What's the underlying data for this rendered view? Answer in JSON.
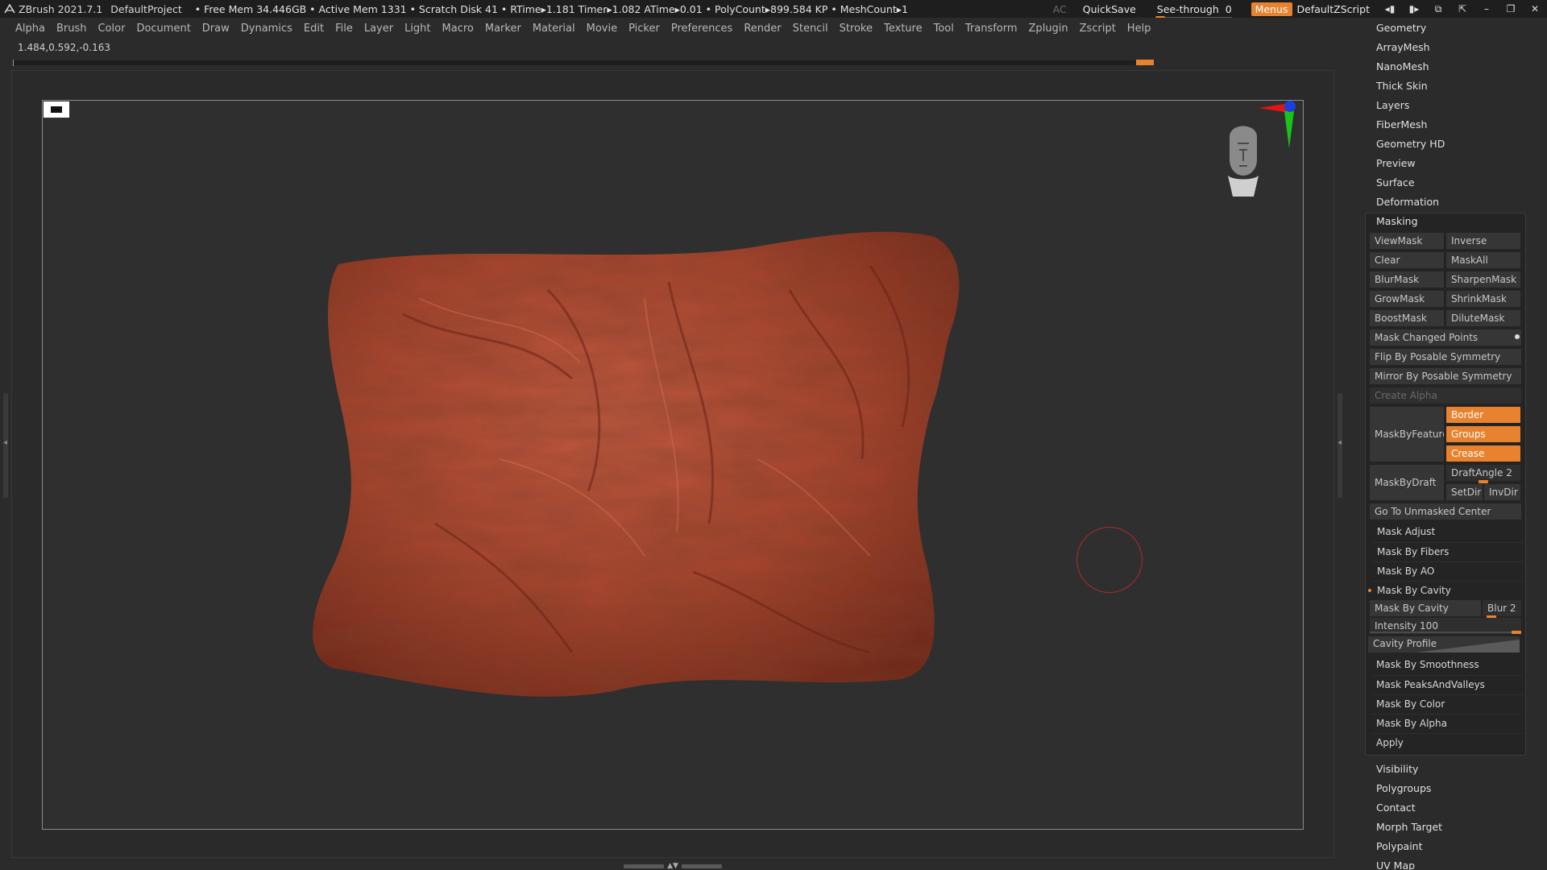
{
  "titlebar": {
    "app": "ZBrush 2021.7.1",
    "project": "DefaultProject",
    "stats": "• Free Mem 34.446GB • Active Mem 1331 • Scratch Disk 41 •  RTime▸1.181 Timer▸1.082 ATime▸0.01 • PolyCount▸899.584 KP  • MeshCount▸1",
    "ac": "AC",
    "quicksave": "QuickSave",
    "seethrough_label": "See-through",
    "seethrough_value": "0",
    "menus": "Menus",
    "zscript": "DefaultZScript"
  },
  "menus": [
    "Alpha",
    "Brush",
    "Color",
    "Document",
    "Draw",
    "Dynamics",
    "Edit",
    "File",
    "Layer",
    "Light",
    "Macro",
    "Marker",
    "Material",
    "Movie",
    "Picker",
    "Preferences",
    "Render",
    "Stencil",
    "Stroke",
    "Texture",
    "Tool",
    "Transform",
    "Zplugin",
    "Zscript",
    "Help"
  ],
  "coords": "1.484,0.592,-0.163",
  "panel": {
    "top_sections": [
      "Geometry",
      "ArrayMesh",
      "NanoMesh",
      "Thick Skin",
      "Layers",
      "FiberMesh",
      "Geometry HD",
      "Preview",
      "Surface",
      "Deformation"
    ],
    "masking": {
      "header": "Masking",
      "viewmask": "ViewMask",
      "inverse": "Inverse",
      "clear": "Clear",
      "maskall": "MaskAll",
      "blurmask": "BlurMask",
      "sharpenmask": "SharpenMask",
      "growmask": "GrowMask",
      "shrinkmask": "ShrinkMask",
      "boostmask": "BoostMask",
      "dilutemask": "DiluteMask",
      "mask_changed_points": "Mask Changed Points",
      "flip_by_posable_symmetry": "Flip By Posable Symmetry",
      "mirror_by_posable_symmetry": "Mirror By Posable Symmetry",
      "create_alpha": "Create Alpha",
      "maskbyfeature": "MaskByFeature",
      "border": "Border",
      "groups": "Groups",
      "crease": "Crease",
      "maskbydraft": "MaskByDraft",
      "draftangle": "DraftAngle 2",
      "setdir": "SetDir",
      "invdir": "InvDir",
      "go_to_unmasked_center": "Go To Unmasked Center",
      "mask_adjust": "Mask Adjust",
      "mask_by_fibers": "Mask By Fibers",
      "mask_by_ao": "Mask By AO",
      "mask_by_cavity_header": "Mask By Cavity",
      "mask_by_cavity_btn": "Mask By Cavity",
      "blur": "Blur 2",
      "intensity": "Intensity 100",
      "cavity_profile": "Cavity Profile",
      "mask_by_smoothness": "Mask By Smoothness",
      "mask_peaks_and_valleys": "Mask PeaksAndValleys",
      "mask_by_color": "Mask By Color",
      "mask_by_alpha": "Mask By Alpha",
      "apply": "Apply"
    },
    "bottom_sections": [
      "Visibility",
      "Polygroups",
      "Contact",
      "Morph Target",
      "Polypaint",
      "UV Map"
    ]
  },
  "colors": {
    "accent": "#e8822e",
    "mesh": "#a8442f",
    "background": "#2b2b2b"
  }
}
